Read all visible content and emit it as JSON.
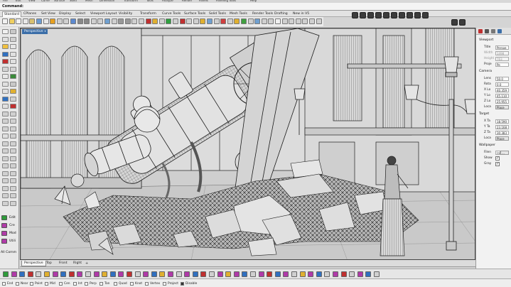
{
  "menu": {
    "items": [
      "File",
      "Edit",
      "View",
      "Curve",
      "Surface",
      "Solid",
      "Mesh",
      "Dimension",
      "Transform",
      "Tools",
      "Analyze",
      "Render",
      "Panels",
      "Paneling Tools",
      "Help"
    ]
  },
  "command": {
    "label": "Command:",
    "value": ""
  },
  "toolbar_tabs": [
    "Standard",
    "CPlanes",
    "Set View",
    "Display",
    "Select",
    "Viewport Layout",
    "Visibility",
    "Transform",
    "Curve Tools",
    "Surface Tools",
    "Solid Tools",
    "Mesh Tools",
    "Render Tools",
    "Drafting",
    "New in V5"
  ],
  "active_toolbar_tab": "Standard",
  "viewport": {
    "active_label": "Perspective",
    "tabs": [
      "Perspective",
      "Top",
      "Front",
      "Right"
    ],
    "add_tab": "+"
  },
  "left_panel": {
    "items": [
      {
        "label": "Edit",
        "icon": "edit-icon",
        "color": "#2e9b3a"
      },
      {
        "label": "Cre",
        "icon": "create-icon",
        "color": "#b03aa8"
      },
      {
        "label": "Mod",
        "icon": "modify-icon",
        "color": "#b03aa8"
      },
      {
        "label": "Utili",
        "icon": "utilities-icon",
        "color": "#b03aa8"
      }
    ],
    "all_commands": "All Comm"
  },
  "properties": {
    "tab_icons": [
      "properties-tab-icon",
      "layers-tab-icon",
      "display-tab-icon",
      "help-tab-icon"
    ],
    "viewport_section": "Viewport",
    "title": {
      "label": "Title",
      "value": "Perspe"
    },
    "width": {
      "label": "Width",
      "value": "1498"
    },
    "height": {
      "label": "Height",
      "value": "763"
    },
    "projection": {
      "label": "Proje",
      "value": "Pe"
    },
    "camera_section": "Camera",
    "lens": {
      "label": "Lens",
      "value": "50.0"
    },
    "rotation": {
      "label": "Rota",
      "value": "0.0"
    },
    "x_location": {
      "label": "X Lo",
      "value": "40.359"
    },
    "y_location": {
      "label": "Y Lo",
      "value": "45.110"
    },
    "z_location": {
      "label": "Z Lo",
      "value": "25.955"
    },
    "camera_place": {
      "label": "Loca",
      "button": "Place"
    },
    "target_section": "Target",
    "x_target": {
      "label": "X Ta",
      "value": "18.590"
    },
    "y_target": {
      "label": "Y Ta",
      "value": "23.168"
    },
    "z_target": {
      "label": "Z Ta",
      "value": "30.383"
    },
    "target_place": {
      "label": "Loca",
      "button": "Place"
    },
    "wallpaper_section": "Wallpaper",
    "filename": {
      "label": "Filen",
      "value": "(no"
    },
    "show": {
      "label": "Show",
      "checked": true
    },
    "gray": {
      "label": "Gray",
      "checked": true
    }
  },
  "osnaps": {
    "items": [
      {
        "label": "End",
        "checked": false
      },
      {
        "label": "Near",
        "checked": false
      },
      {
        "label": "Point",
        "checked": false
      },
      {
        "label": "Mid",
        "checked": false
      },
      {
        "label": "Cen",
        "checked": false
      },
      {
        "label": "Int",
        "checked": false
      },
      {
        "label": "Perp",
        "checked": false
      },
      {
        "label": "Tan",
        "checked": false
      },
      {
        "label": "Quad",
        "checked": false
      },
      {
        "label": "Knot",
        "checked": false
      },
      {
        "label": "Vertex",
        "checked": false
      },
      {
        "label": "Project",
        "checked": false
      },
      {
        "label": "Disable",
        "checked": true
      }
    ]
  },
  "colors": {
    "viewport_label_bg": "#3b6ea8",
    "wireframe": "#1e1e1e",
    "shaded": "#d2d2d2"
  }
}
